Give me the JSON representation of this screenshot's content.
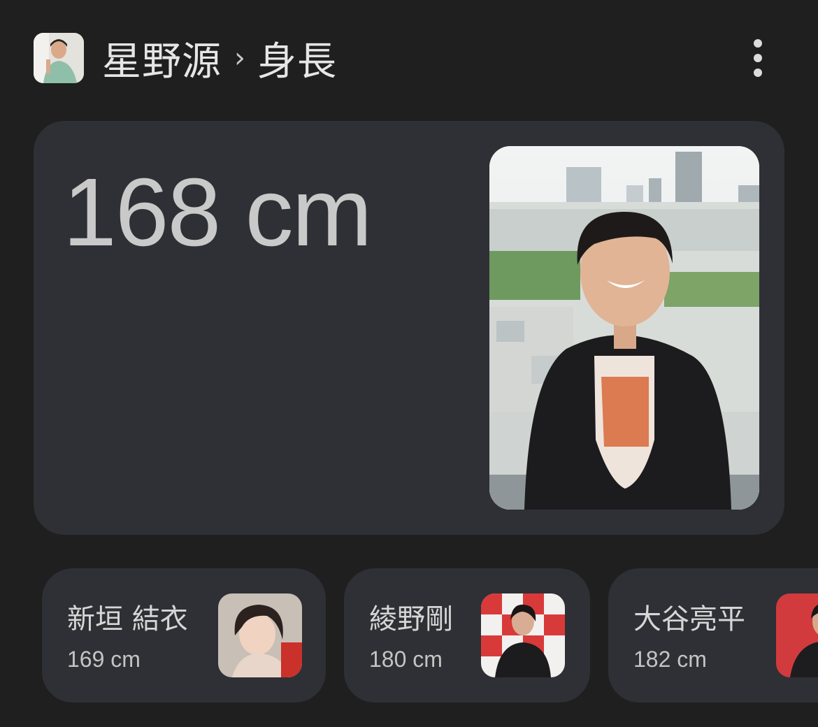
{
  "header": {
    "entity": "星野源",
    "separator": "›",
    "attribute": "身長",
    "more_icon": "more-vert-icon"
  },
  "main": {
    "height_value": "168 cm"
  },
  "related": [
    {
      "name": "新垣 結衣",
      "height": "169 cm"
    },
    {
      "name": "綾野剛",
      "height": "180 cm"
    },
    {
      "name": "大谷亮平",
      "height": "182 cm"
    }
  ],
  "colors": {
    "background": "#1f1f20",
    "card": "#2f3035",
    "text": "#e3e3e3"
  }
}
